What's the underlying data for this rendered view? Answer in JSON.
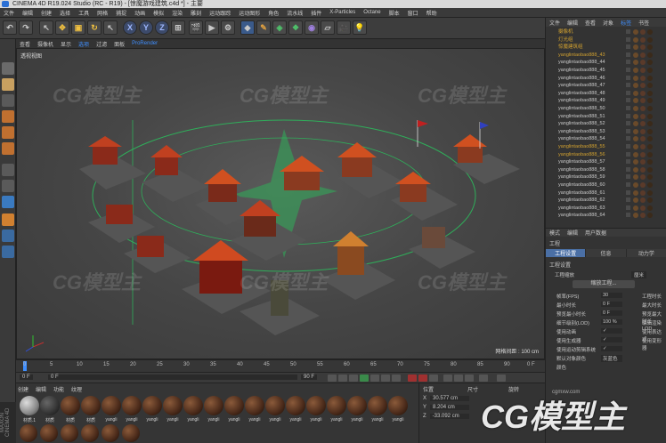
{
  "window": {
    "title": "CINEMA 4D R19.024 Studio (RC - R19) - [惊魔游戏建筑.c4d *] - 主要"
  },
  "menubar": [
    "文件",
    "编辑",
    "创建",
    "选择",
    "工具",
    "网格",
    "捕捉",
    "动画",
    "模拟",
    "渲染",
    "雕刻",
    "运动跟踪",
    "运动图形",
    "角色",
    "流水线",
    "插件",
    "X-Particles",
    "Octane",
    "脚本",
    "窗口",
    "帮助"
  ],
  "toolbar": {
    "x": "X",
    "y": "Y",
    "z": "Z"
  },
  "viewport": {
    "menu": [
      "查看",
      "摄像机",
      "显示",
      "选项",
      "过滤",
      "面板",
      "ProRender"
    ],
    "label": "透视视图",
    "grid_label": "网格间距 : 100 cm",
    "watermark": "CG模型主"
  },
  "timeline": {
    "ticks": [
      "0",
      "5",
      "10",
      "15",
      "20",
      "25",
      "30",
      "35",
      "40",
      "45",
      "50",
      "55",
      "60",
      "65",
      "70",
      "75",
      "80",
      "85",
      "90"
    ],
    "end_frame": "0 F",
    "current": "0 F",
    "start_field": "0 F",
    "end_field": "90 F"
  },
  "materials": {
    "tabs": [
      "创建",
      "编辑",
      "功能",
      "纹理"
    ],
    "items": [
      "材质.1",
      "材质",
      "材质",
      "材质",
      "yangli",
      "yangli",
      "yangli",
      "yangli",
      "yangli",
      "yangli",
      "yangli",
      "yangli",
      "yangli",
      "yangli",
      "yangli",
      "yangli",
      "yangli",
      "yangli",
      "yangli"
    ]
  },
  "maxon": "MAXON CINEMA 4D",
  "coords": {
    "headers": [
      "位置",
      "尺寸",
      "旋转"
    ],
    "rows": [
      {
        "axis": "X",
        "val": "30.577 cm"
      },
      {
        "axis": "Y",
        "val": "8.204 cm"
      },
      {
        "axis": "Z",
        "val": "-33.092 cm"
      }
    ]
  },
  "objmgr": {
    "tabs": [
      "文件",
      "编辑",
      "查看",
      "对象",
      "标签",
      "书签"
    ],
    "rows": [
      {
        "name": "摄像机",
        "color": "#d0a030"
      },
      {
        "name": "灯光组",
        "color": "#d0a030"
      },
      {
        "name": "惊魔建筑组",
        "color": "#d0a030"
      },
      {
        "name": "yanglintaobao888_43",
        "color": "#d0a030"
      },
      {
        "name": "yanglintaobao888_44",
        "color": "#c8c8c8"
      },
      {
        "name": "yanglintaobao888_45",
        "color": "#c8c8c8"
      },
      {
        "name": "yanglintaobao888_46",
        "color": "#c8c8c8"
      },
      {
        "name": "yanglintaobao888_47",
        "color": "#c8c8c8"
      },
      {
        "name": "yanglintaobao888_48",
        "color": "#c8c8c8"
      },
      {
        "name": "yanglintaobao888_49",
        "color": "#c8c8c8"
      },
      {
        "name": "yanglintaobao888_50",
        "color": "#c8c8c8"
      },
      {
        "name": "yanglintaobao888_51",
        "color": "#c8c8c8"
      },
      {
        "name": "yanglintaobao888_52",
        "color": "#c8c8c8"
      },
      {
        "name": "yanglintaobao888_53",
        "color": "#c8c8c8"
      },
      {
        "name": "yanglintaobao888_54",
        "color": "#c8c8c8"
      },
      {
        "name": "yanglintaobao888_55",
        "color": "#d0a030"
      },
      {
        "name": "yanglintaobao888_56",
        "color": "#d0a030"
      },
      {
        "name": "yanglintaobao888_57",
        "color": "#c8c8c8"
      },
      {
        "name": "yanglintaobao888_58",
        "color": "#c8c8c8"
      },
      {
        "name": "yanglintaobao888_59",
        "color": "#c8c8c8"
      },
      {
        "name": "yanglintaobao888_60",
        "color": "#c8c8c8"
      },
      {
        "name": "yanglintaobao888_61",
        "color": "#c8c8c8"
      },
      {
        "name": "yanglintaobao888_62",
        "color": "#c8c8c8"
      },
      {
        "name": "yanglintaobao888_63",
        "color": "#c8c8c8"
      },
      {
        "name": "yanglintaobao888_64",
        "color": "#c8c8c8"
      }
    ]
  },
  "attr": {
    "tabs": [
      "模式",
      "编辑",
      "用户数据"
    ],
    "mode": "工程",
    "subtabs": [
      "工程设置",
      "信息",
      "动力学"
    ],
    "section": "工程设置",
    "scale_label": "工程缩放",
    "scale_unit": "厘米",
    "button": "缩放工程...",
    "rows": [
      {
        "lbl": "帧率(FPS)",
        "v": "30",
        "lbl2": "工程时长"
      },
      {
        "lbl": "最小时长",
        "v": "0 F",
        "lbl2": "最大时长"
      },
      {
        "lbl": "预览最小时长",
        "v": "0 F",
        "lbl2": "预览最大时长"
      },
      {
        "lbl": "细节级别(LOD)",
        "v": "100 %",
        "lbl2": "编辑渲染LOD"
      },
      {
        "lbl": "使用动画",
        "v": "✓",
        "lbl2": "使用表达式"
      },
      {
        "lbl": "使用生成器",
        "v": "✓",
        "lbl2": "使用变形器"
      },
      {
        "lbl": "使用运动剪辑系统",
        "v": "✓",
        "lbl2": ""
      },
      {
        "lbl": "默认对象颜色",
        "v": "灰蓝色",
        "lbl2": ""
      },
      {
        "lbl": "颜色",
        "v": "",
        "lbl2": ""
      }
    ]
  },
  "brand_watermark": "CG模型主",
  "brand_url": "cgmxw.com"
}
